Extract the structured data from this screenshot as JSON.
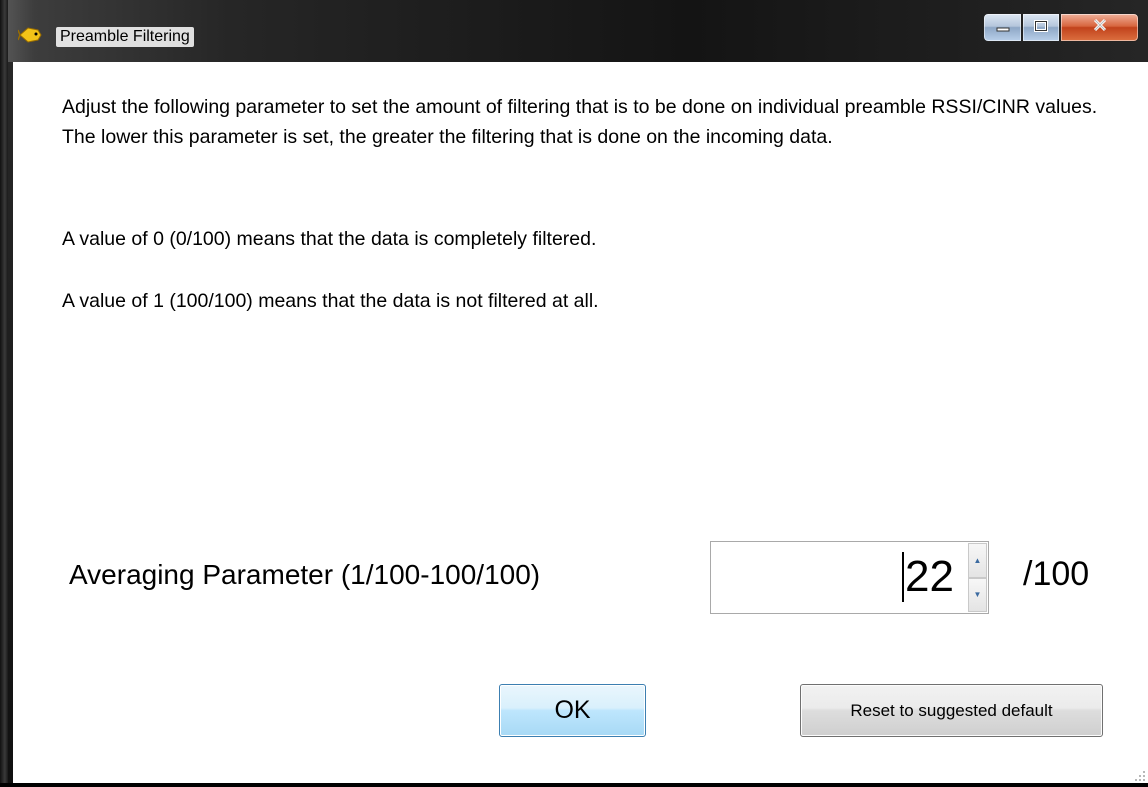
{
  "window": {
    "title": "Preamble Filtering"
  },
  "description": {
    "paragraph1": "Adjust the following parameter to set the amount of filtering that is to be done on individual preamble RSSI/CINR values. The lower this parameter is set, the greater the filtering that is done on the incoming data.",
    "paragraph2": "A value of 0 (0/100) means that the data is completely filtered.",
    "paragraph3": "A value of 1 (100/100) means that the data is not filtered at all."
  },
  "averaging": {
    "label": "Averaging Parameter (1/100-100/100)",
    "value": "22",
    "suffix": "/100"
  },
  "buttons": {
    "ok_label": "OK",
    "reset_label": "Reset to suggested default"
  },
  "colors": {
    "title_bar": "#141414",
    "client_background": "#ffffff",
    "close_button": "#c1421c",
    "ok_button": "#bee6fd"
  },
  "icons": {
    "app": "yellow-fish-icon",
    "minimize": "minimize-icon",
    "maximize": "maximize-icon",
    "close": "close-icon",
    "spin_up": "chevron-up-icon",
    "spin_down": "chevron-down-icon",
    "grip": "resize-grip-icon"
  }
}
